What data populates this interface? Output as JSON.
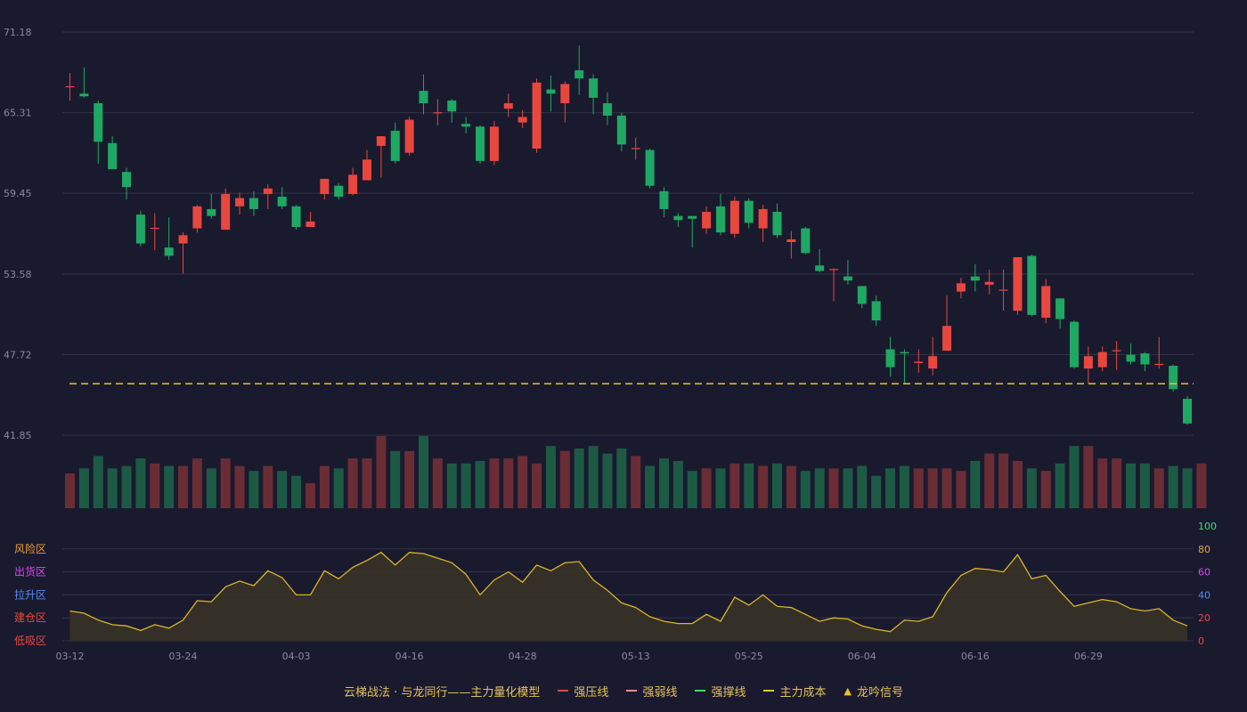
{
  "colors": {
    "background": "#1a1a2e",
    "grid": "#343448",
    "axis_text": "#8a8a9a",
    "up": "#e8473f",
    "down": "#1fa863",
    "vol_up": "#6a2d35",
    "vol_down": "#1d5a45",
    "cost_line": "#e8c52a",
    "osc_line": "#d9b52a",
    "osc_fill": "#3a3426"
  },
  "chart_data": [
    {
      "type": "candlestick",
      "price_axis": {
        "ticks": [
          "71.18",
          "65.31",
          "59.45",
          "53.58",
          "47.72",
          "41.85"
        ],
        "ylim": [
          41.85,
          71.18
        ]
      },
      "x_tick_labels": [
        {
          "label": "03-12",
          "index": 0
        },
        {
          "label": "03-24",
          "index": 8
        },
        {
          "label": "04-03",
          "index": 16
        },
        {
          "label": "04-16",
          "index": 24
        },
        {
          "label": "04-28",
          "index": 32
        },
        {
          "label": "05-13",
          "index": 40
        },
        {
          "label": "05-25",
          "index": 48
        },
        {
          "label": "06-04",
          "index": 56
        },
        {
          "label": "06-16",
          "index": 64
        },
        {
          "label": "06-29",
          "index": 72
        }
      ],
      "cost_line": 45.6,
      "candles": [
        [
          67.2,
          67.2,
          68.2,
          66.2
        ],
        [
          66.7,
          66.5,
          68.6,
          66.4
        ],
        [
          66.0,
          63.2,
          66.2,
          61.6
        ],
        [
          63.1,
          61.2,
          63.6,
          61.2
        ],
        [
          61.0,
          59.9,
          61.3,
          59.0
        ],
        [
          57.9,
          55.8,
          58.2,
          55.6
        ],
        [
          56.9,
          56.9,
          58.0,
          55.3
        ],
        [
          55.5,
          54.9,
          57.7,
          54.6
        ],
        [
          55.8,
          56.4,
          56.6,
          53.6
        ],
        [
          56.9,
          58.5,
          58.6,
          56.6
        ],
        [
          58.3,
          57.8,
          59.4,
          57.6
        ],
        [
          56.8,
          59.4,
          59.8,
          56.8
        ],
        [
          58.5,
          59.1,
          59.5,
          57.9
        ],
        [
          59.1,
          58.3,
          59.6,
          57.8
        ],
        [
          59.4,
          59.8,
          60.1,
          58.3
        ],
        [
          59.2,
          58.5,
          59.9,
          58.3
        ],
        [
          58.5,
          57.0,
          58.6,
          56.8
        ],
        [
          57.0,
          57.4,
          58.1,
          57.0
        ],
        [
          59.4,
          60.5,
          60.5,
          59.0
        ],
        [
          60.0,
          59.2,
          60.2,
          59.0
        ],
        [
          59.4,
          60.8,
          61.3,
          59.3
        ],
        [
          60.4,
          61.9,
          62.6,
          60.4
        ],
        [
          62.9,
          63.6,
          63.6,
          60.6
        ],
        [
          64.0,
          61.8,
          64.6,
          61.6
        ],
        [
          62.4,
          64.8,
          65.0,
          62.2
        ],
        [
          66.9,
          66.0,
          68.1,
          65.2
        ],
        [
          65.3,
          65.3,
          66.3,
          64.4
        ],
        [
          66.2,
          65.4,
          66.3,
          64.6
        ],
        [
          64.5,
          64.3,
          65.0,
          63.8
        ],
        [
          64.3,
          61.8,
          64.4,
          61.6
        ],
        [
          61.8,
          64.3,
          64.7,
          61.5
        ],
        [
          65.6,
          66.0,
          66.7,
          65.0
        ],
        [
          64.6,
          65.0,
          65.5,
          64.2
        ],
        [
          62.7,
          67.5,
          67.8,
          62.4
        ],
        [
          67.0,
          66.7,
          68.0,
          65.4
        ],
        [
          66.0,
          67.4,
          67.6,
          64.6
        ],
        [
          68.4,
          67.8,
          70.2,
          66.6
        ],
        [
          67.8,
          66.4,
          68.1,
          65.2
        ],
        [
          66.0,
          65.1,
          66.8,
          64.4
        ],
        [
          65.1,
          63.0,
          65.3,
          62.5
        ],
        [
          62.7,
          62.7,
          63.5,
          61.9
        ],
        [
          62.6,
          60.0,
          62.7,
          59.8
        ],
        [
          59.6,
          58.3,
          59.9,
          57.7
        ],
        [
          57.8,
          57.5,
          58.0,
          57.0
        ],
        [
          57.8,
          57.6,
          57.8,
          55.5
        ],
        [
          56.9,
          58.1,
          58.5,
          56.5
        ],
        [
          58.5,
          56.6,
          59.4,
          56.4
        ],
        [
          56.5,
          58.9,
          59.2,
          56.2
        ],
        [
          58.9,
          57.3,
          59.1,
          56.9
        ],
        [
          56.9,
          58.3,
          58.6,
          55.9
        ],
        [
          58.1,
          56.4,
          58.7,
          56.2
        ],
        [
          55.9,
          56.1,
          56.7,
          54.7
        ],
        [
          56.9,
          55.1,
          57.0,
          55.0
        ],
        [
          54.2,
          53.8,
          55.4,
          53.7
        ],
        [
          53.9,
          53.9,
          54.0,
          51.6
        ],
        [
          53.4,
          53.1,
          54.6,
          52.8
        ],
        [
          52.7,
          51.4,
          52.7,
          51.1
        ],
        [
          51.6,
          50.2,
          52.0,
          49.8
        ],
        [
          48.1,
          46.8,
          49.0,
          46.1
        ],
        [
          47.9,
          47.8,
          48.1,
          45.6
        ],
        [
          47.1,
          47.2,
          48.1,
          46.4
        ],
        [
          46.7,
          47.6,
          49.0,
          46.2
        ],
        [
          48.0,
          49.8,
          52.0,
          48.0
        ],
        [
          52.3,
          52.9,
          53.3,
          51.8
        ],
        [
          53.4,
          53.1,
          54.3,
          52.3
        ],
        [
          52.8,
          53.0,
          53.9,
          52.1
        ],
        [
          52.4,
          52.4,
          53.9,
          50.9
        ],
        [
          50.9,
          54.8,
          54.8,
          50.6
        ],
        [
          54.9,
          50.6,
          55.0,
          50.5
        ],
        [
          50.4,
          52.7,
          53.2,
          50.0
        ],
        [
          51.8,
          50.3,
          51.8,
          49.6
        ],
        [
          50.1,
          46.8,
          50.2,
          46.7
        ],
        [
          46.7,
          47.6,
          48.3,
          45.6
        ],
        [
          46.8,
          47.9,
          48.3,
          46.5
        ],
        [
          48.0,
          48.0,
          48.7,
          46.6
        ],
        [
          47.7,
          47.2,
          48.5,
          47.0
        ],
        [
          47.8,
          47.0,
          47.9,
          46.5
        ],
        [
          47.0,
          47.0,
          49.0,
          46.7
        ],
        [
          46.9,
          45.2,
          47.0,
          45.0
        ],
        [
          44.5,
          42.7,
          44.7,
          42.6
        ]
      ],
      "volume": [
        14,
        16,
        21,
        16,
        17,
        20,
        18,
        17,
        17,
        20,
        16,
        20,
        17,
        15,
        17,
        15,
        13,
        10,
        17,
        16,
        20,
        20,
        29,
        23,
        23,
        29,
        20,
        18,
        18,
        19,
        20,
        20,
        21,
        18,
        25,
        23,
        24,
        25,
        22,
        24,
        21,
        17,
        20,
        19,
        15,
        16,
        16,
        18,
        18,
        17,
        18,
        17,
        15,
        16,
        16,
        16,
        17,
        13,
        16,
        17,
        16,
        16,
        16,
        15,
        19,
        22,
        22,
        19,
        16,
        15,
        18,
        25,
        25,
        20,
        20,
        18,
        18,
        16,
        17,
        16,
        18
      ],
      "volume_up": [
        1,
        1,
        1,
        1,
        1,
        1,
        1,
        1,
        1,
        1,
        1,
        1,
        1,
        1,
        1,
        1,
        1,
        1,
        1,
        1,
        1,
        1,
        1,
        1,
        1,
        1,
        1,
        1,
        1,
        1,
        1,
        1,
        1,
        1,
        1,
        1,
        1,
        1,
        1,
        1,
        1,
        1,
        1,
        1,
        1,
        1,
        1,
        1,
        1,
        1,
        1,
        1,
        1,
        1,
        1,
        1,
        1,
        1,
        1,
        1,
        1,
        1,
        1,
        1,
        1,
        1,
        1,
        1,
        1,
        1,
        1,
        1,
        1,
        1,
        1,
        1,
        1,
        1,
        1,
        1,
        1
      ]
    },
    {
      "type": "line",
      "title": "云梯战法 · 与龙同行——主力量化模型",
      "zones": [
        "风险区",
        "出货区",
        "拉升区",
        "建仓区",
        "低吸区"
      ],
      "zone_colors": [
        "#e89a3a",
        "#d946ef",
        "#4f8cf5",
        "#e8473f",
        "#e8473f"
      ],
      "yticks": [
        "100",
        "80",
        "60",
        "40",
        "20",
        "0"
      ],
      "ytick_colors": [
        "#33e06a",
        "#e8a13a",
        "#d946ef",
        "#4f8cf5",
        "#e8473f",
        "#e8473f"
      ],
      "ylim": [
        0,
        100
      ],
      "values": [
        26,
        24,
        18,
        14,
        13,
        9,
        14,
        11,
        18,
        35,
        34,
        47,
        52,
        48,
        61,
        55,
        40,
        40,
        61,
        54,
        64,
        70,
        77,
        66,
        77,
        76,
        72,
        68,
        58,
        40,
        53,
        60,
        51,
        66,
        61,
        68,
        69,
        53,
        44,
        33,
        29,
        21,
        17,
        15,
        15,
        23,
        17,
        38,
        31,
        40,
        30,
        29,
        23,
        17,
        20,
        19,
        13,
        10,
        8,
        18,
        17,
        21,
        42,
        57,
        63,
        62,
        60,
        75,
        54,
        57,
        43,
        30,
        33,
        36,
        34,
        28,
        26,
        28,
        18,
        13
      ]
    }
  ],
  "legend": {
    "title": "云梯战法 · 与龙同行——主力量化模型",
    "items": [
      {
        "label": "强压线",
        "color": "#e8473f",
        "style": "solid"
      },
      {
        "label": "强弱线",
        "color": "#ff8a8a",
        "style": "dash"
      },
      {
        "label": "强撑线",
        "color": "#3ee060",
        "style": "solid"
      },
      {
        "label": "主力成本",
        "color": "#e8c52a",
        "style": "dash"
      },
      {
        "label": "龙吟信号",
        "color": "#e8c52a",
        "style": "triangle"
      }
    ]
  }
}
